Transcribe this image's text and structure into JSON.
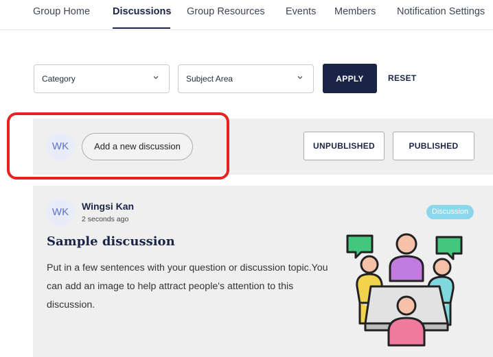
{
  "nav": {
    "tabs": [
      {
        "label": "Group Home",
        "active": false
      },
      {
        "label": "Discussions",
        "active": true
      },
      {
        "label": "Group Resources",
        "active": false
      },
      {
        "label": "Events",
        "active": false
      },
      {
        "label": "Members",
        "active": false
      },
      {
        "label": "Notification Settings",
        "active": false
      }
    ]
  },
  "filters": {
    "category_label": "Category",
    "subject_area_label": "Subject Area",
    "apply_label": "APPLY",
    "reset_label": "RESET"
  },
  "composer": {
    "avatar_initials": "WK",
    "new_discussion_label": "Add a new discussion",
    "unpublished_label": "UNPUBLISHED",
    "published_label": "PUBLISHED"
  },
  "post": {
    "avatar_initials": "WK",
    "author": "Wingsi Kan",
    "timestamp": "2 seconds ago",
    "badge": "Discussion",
    "title": "Sample discussion",
    "body": "Put in a few sentences with your question or discussion topic.You can add an image to help attract people's attention to this discussion."
  },
  "colors": {
    "primary": "#1b2447",
    "highlight": "#e5221f",
    "badge": "#8ad6ea",
    "panel": "#efefef"
  }
}
